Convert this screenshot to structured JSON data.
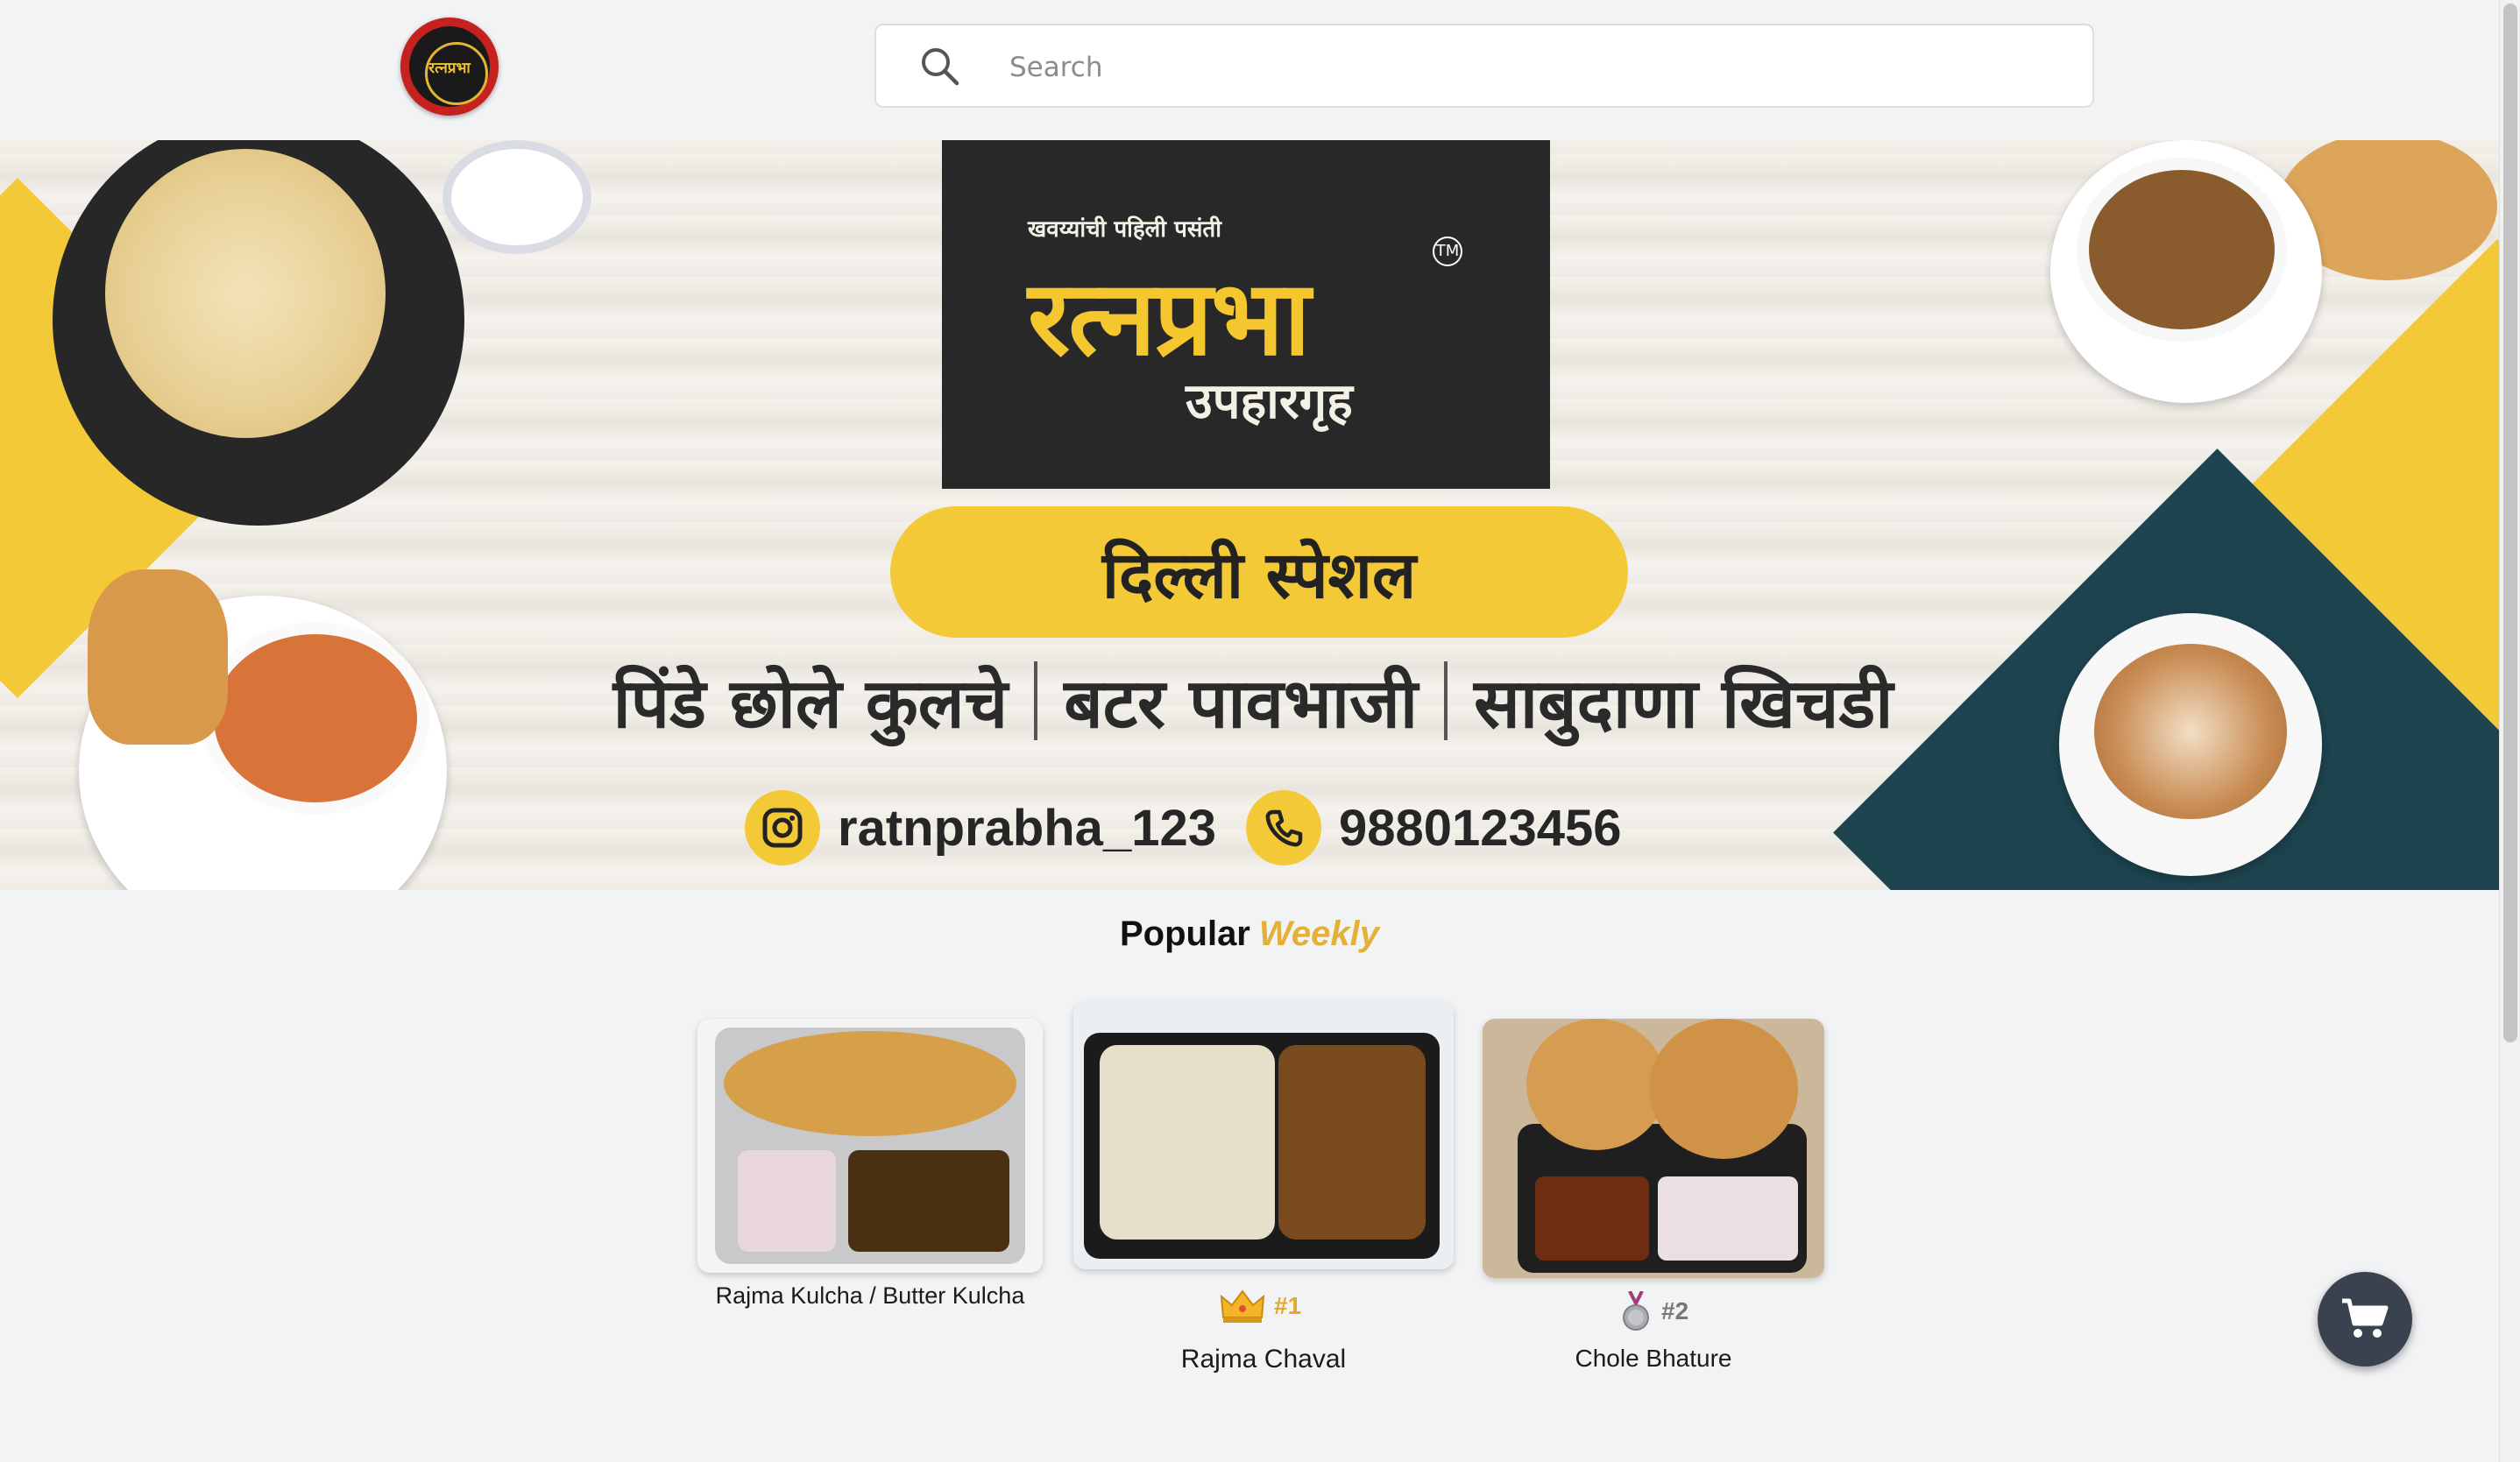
{
  "header": {
    "logo_text": "रत्नप्रभा",
    "search": {
      "placeholder": "Search",
      "value": ""
    }
  },
  "banner": {
    "tagline": "खवय्यांची पहिली पसंती",
    "brand_name": "रत्नप्रभा",
    "brand_sub": "उपहारगृह",
    "tm": "TM",
    "special_title": "दिल्ली स्पेशल",
    "specials": [
      "पिंडे छोले कुलचे",
      "बटर पावभाजी",
      "साबुदाणा खिचडी"
    ],
    "instagram": "ratnprabha_123",
    "phone": "9880123456"
  },
  "popular": {
    "title": "Popular",
    "accent": "Weekly",
    "accent_color": "#e3b137",
    "items": [
      {
        "name": "Rajma Kulcha / Butter Kulcha",
        "rank": ""
      },
      {
        "name": "Rajma Chaval",
        "rank": "#1",
        "badge_icon": "crown-icon"
      },
      {
        "name": "Chole Bhature",
        "rank": "#2",
        "badge_icon": "silver-medal-icon"
      }
    ]
  },
  "cart": {
    "icon": "cart-icon",
    "color": "#3a4250"
  }
}
